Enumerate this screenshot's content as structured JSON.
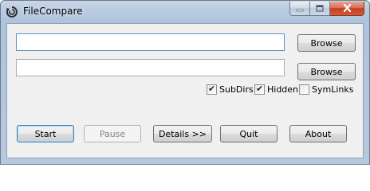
{
  "window": {
    "title": "FileCompare"
  },
  "paths": {
    "left_value": "",
    "right_value": ""
  },
  "buttons": {
    "browse_1": "Browse",
    "browse_2": "Browse",
    "start": "Start",
    "pause": "Pause",
    "details": "Details >>",
    "quit": "Quit",
    "about": "About"
  },
  "options": {
    "subdirs": {
      "label": "SubDirs",
      "checked": true
    },
    "hidden": {
      "label": "Hidden",
      "checked": true
    },
    "symlinks": {
      "label": "SymLinks",
      "checked": false
    }
  },
  "icons": {
    "app": "app-icon",
    "minimize": "minimize-icon",
    "maximize": "maximize-icon",
    "close": "close-icon"
  },
  "colors": {
    "title_bar": "#b9cbe0",
    "client_bg": "#f0f0f0",
    "close_button": "#c4401f",
    "default_button_border": "#3c7fb1"
  }
}
